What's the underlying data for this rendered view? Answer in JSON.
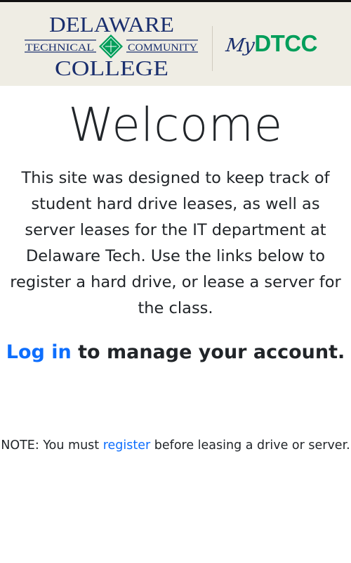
{
  "header": {
    "logo_line1": "DELAWARE",
    "logo_left": "TECHNICAL",
    "logo_right": "COMMUNITY",
    "logo_line3": "COLLEGE",
    "portal_my": "My",
    "portal_name": "DTCC"
  },
  "main": {
    "title": "Welcome",
    "intro": "This site was designed to keep track of student hard drive leases, as well as server leases for the IT department at Delaware Tech. Use the links below to register a hard drive, or lease a server for the class.",
    "login_link": "Log in",
    "login_suffix": " to manage your account.",
    "note_prefix": "NOTE: You must ",
    "register_link": "register",
    "note_suffix": " before leasing a drive or server."
  },
  "colors": {
    "header_bg": "#efede4",
    "logo_navy": "#1a2f6e",
    "logo_green": "#009e5a",
    "link": "#0d6efd"
  }
}
